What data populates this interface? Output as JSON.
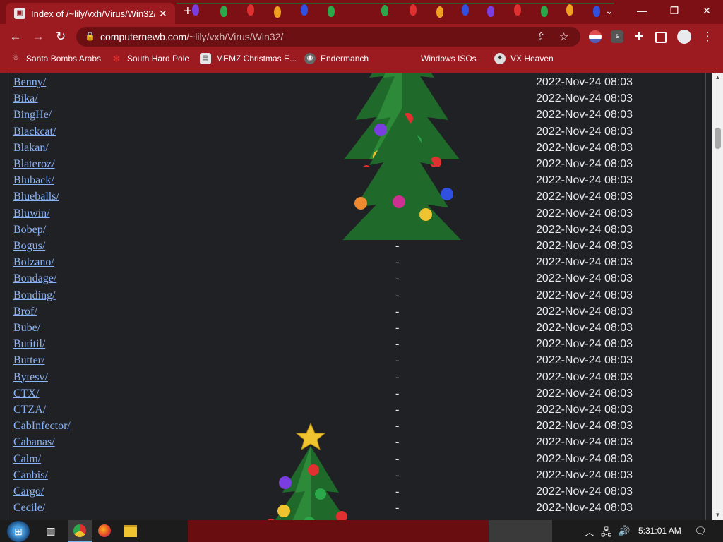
{
  "browser": {
    "tab_title": "Index of /~lily/vxh/Virus/Win32/",
    "tab_close": "✕",
    "new_tab": "+",
    "url_domain": "computernewb.com",
    "url_path": "/~lily/vxh/Virus/Win32/",
    "bookmarks": [
      {
        "label": "Santa Bombs Arabs",
        "icon": "santa-icon"
      },
      {
        "label": "South Hard Pole",
        "icon": "snowflake-icon"
      },
      {
        "label": "MEMZ Christmas E...",
        "icon": "document-icon"
      },
      {
        "label": "Endermanch ",
        "icon": "raccoon-icon"
      },
      {
        "label": "Windows ISOs",
        "icon": "windows-icon"
      },
      {
        "label": "VX Heaven",
        "icon": "vx-icon"
      }
    ]
  },
  "listing": [
    {
      "name": "Benny/",
      "size": "",
      "date": "2022-Nov-24 08:03"
    },
    {
      "name": "Bika/",
      "size": "",
      "date": "2022-Nov-24 08:03"
    },
    {
      "name": "BingHe/",
      "size": "",
      "date": "2022-Nov-24 08:03"
    },
    {
      "name": "Blackcat/",
      "size": "",
      "date": "2022-Nov-24 08:03"
    },
    {
      "name": "Blakan/",
      "size": "",
      "date": "2022-Nov-24 08:03"
    },
    {
      "name": "Blateroz/",
      "size": "-",
      "date": "2022-Nov-24 08:03"
    },
    {
      "name": "Bluback/",
      "size": "-",
      "date": "2022-Nov-24 08:03"
    },
    {
      "name": "Blueballs/",
      "size": "-",
      "date": "2022-Nov-24 08:03"
    },
    {
      "name": "Bluwin/",
      "size": "-",
      "date": "2022-Nov-24 08:03"
    },
    {
      "name": "Bobep/",
      "size": "-",
      "date": "2022-Nov-24 08:03"
    },
    {
      "name": "Bogus/",
      "size": "-",
      "date": "2022-Nov-24 08:03"
    },
    {
      "name": "Bolzano/",
      "size": "-",
      "date": "2022-Nov-24 08:03"
    },
    {
      "name": "Bondage/",
      "size": "-",
      "date": "2022-Nov-24 08:03"
    },
    {
      "name": "Bonding/",
      "size": "-",
      "date": "2022-Nov-24 08:03"
    },
    {
      "name": "Brof/",
      "size": "-",
      "date": "2022-Nov-24 08:03"
    },
    {
      "name": "Bube/",
      "size": "-",
      "date": "2022-Nov-24 08:03"
    },
    {
      "name": "Butitil/",
      "size": "-",
      "date": "2022-Nov-24 08:03"
    },
    {
      "name": "Butter/",
      "size": "-",
      "date": "2022-Nov-24 08:03"
    },
    {
      "name": "Bytesv/",
      "size": "-",
      "date": "2022-Nov-24 08:03"
    },
    {
      "name": "CTX/",
      "size": "-",
      "date": "2022-Nov-24 08:03"
    },
    {
      "name": "CTZA/",
      "size": "-",
      "date": "2022-Nov-24 08:03"
    },
    {
      "name": "CabInfector/",
      "size": "-",
      "date": "2022-Nov-24 08:03"
    },
    {
      "name": "Cabanas/",
      "size": "-",
      "date": "2022-Nov-24 08:03"
    },
    {
      "name": "Calm/",
      "size": "-",
      "date": "2022-Nov-24 08:03"
    },
    {
      "name": "Canbis/",
      "size": "-",
      "date": "2022-Nov-24 08:03"
    },
    {
      "name": "Cargo/",
      "size": "-",
      "date": "2022-Nov-24 08:03"
    },
    {
      "name": "Cecile/",
      "size": "-",
      "date": "2022-Nov-24 08:03"
    }
  ],
  "taskbar": {
    "clock": "5:31:01 AM"
  },
  "colors": {
    "chrome_bg": "#9b1b20",
    "tabstrip_bg": "#7d1014",
    "link": "#8ab4f8",
    "page_bg": "#202124"
  }
}
